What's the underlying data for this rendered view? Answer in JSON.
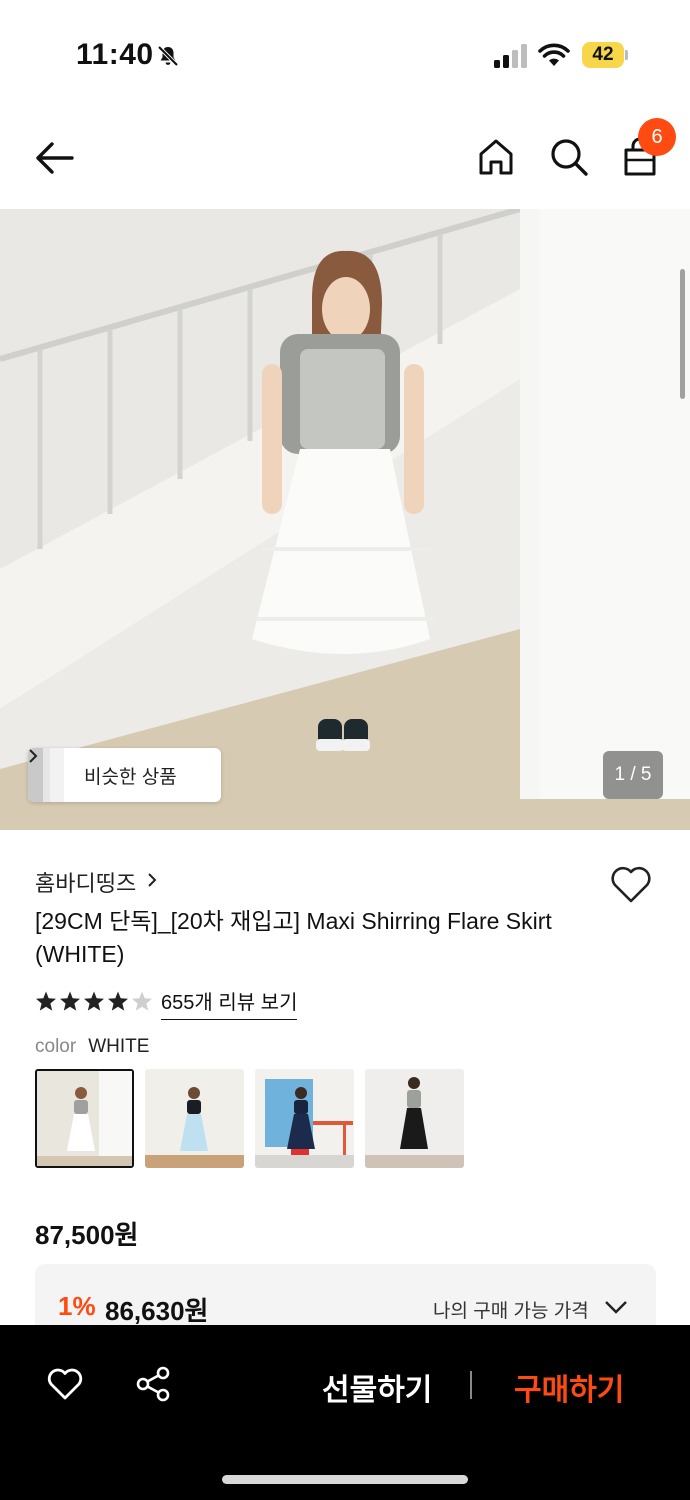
{
  "status_bar": {
    "time": "11:40",
    "battery": "42"
  },
  "nav": {
    "cart_count": "6"
  },
  "hero": {
    "similar_label": "비슷한 상품",
    "page_counter": "1 / 5",
    "current_page": 1,
    "total_pages": 5
  },
  "product": {
    "brand": "홈바디띵즈",
    "title": "[29CM 단독]_[20차 재입고] Maxi Shirring Flare Skirt (WHITE)",
    "rating": 4.5,
    "review_link": "655개 리뷰 보기",
    "color_label": "color",
    "color_value": "WHITE",
    "swatches": [
      {
        "selected": true,
        "top": "#9ea09c",
        "bottom": "#ffffff",
        "bg": "#e9e6de"
      },
      {
        "selected": false,
        "top": "#1b1d24",
        "bottom": "#bfe0f0",
        "bg": "#f1efe9"
      },
      {
        "selected": false,
        "top": "#1a2440",
        "bottom": "#1c2a4c",
        "bg": "#6fb2dc"
      },
      {
        "selected": false,
        "top": "#9ea09c",
        "bottom": "#1a1a1a",
        "bg": "#efeeec"
      }
    ],
    "price": "87,500원",
    "discount_pct": "1%",
    "discount_price": "86,630원",
    "my_price_label": "나의 구매 가능 가격"
  },
  "actions": {
    "gift_label": "선물하기",
    "buy_label": "구매하기"
  },
  "colors": {
    "accent": "#ff4b12",
    "bottom_bar": "#000000"
  }
}
